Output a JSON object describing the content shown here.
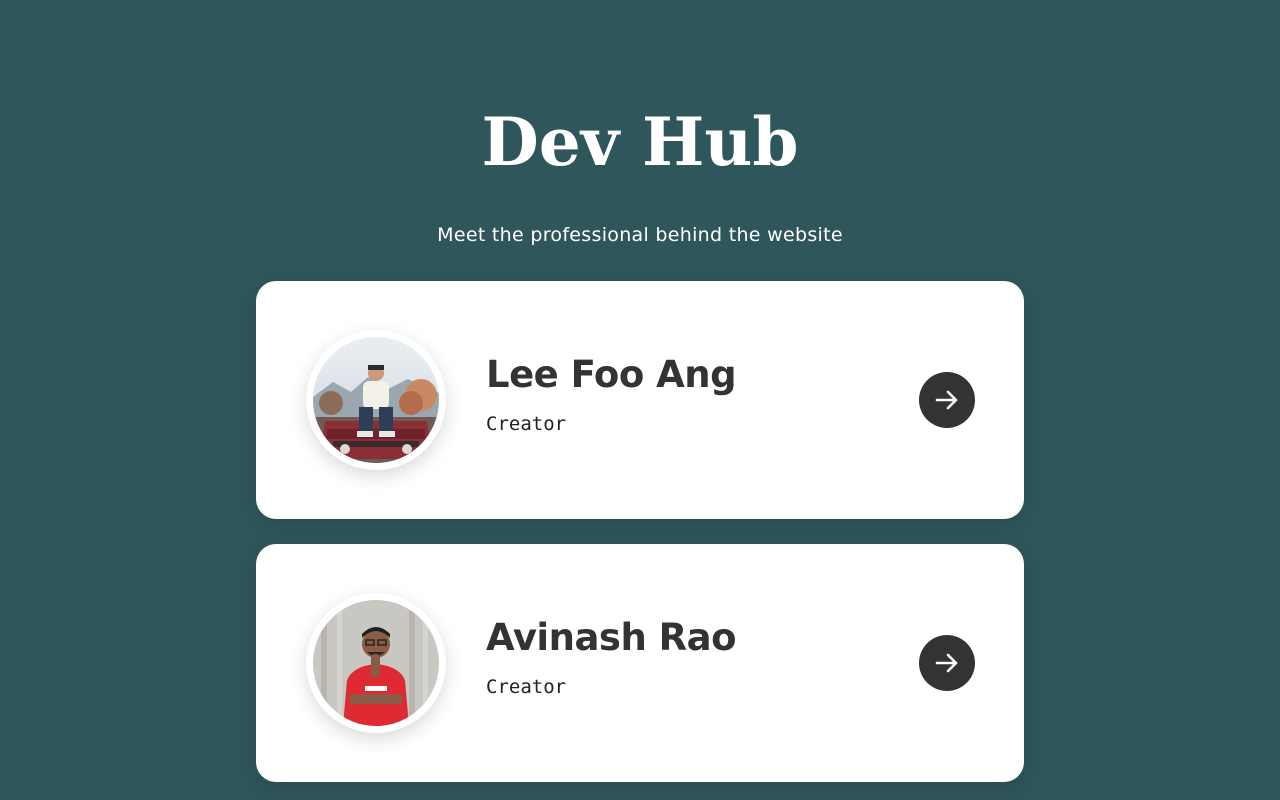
{
  "header": {
    "title": "Dev Hub",
    "subtitle": "Meet the professional behind the website"
  },
  "profiles": [
    {
      "name": "Lee Foo Ang",
      "role": "Creator",
      "avatar": "person-sitting-on-red-jeep-photo",
      "action_icon": "arrow-right-icon"
    },
    {
      "name": "Avinash Rao",
      "role": "Creator",
      "avatar": "person-in-red-jersey-photo",
      "action_icon": "arrow-right-icon"
    }
  ],
  "colors": {
    "background": "#2f565b",
    "card": "#ffffff",
    "accent_dark": "#333333",
    "title": "#ffffff"
  }
}
